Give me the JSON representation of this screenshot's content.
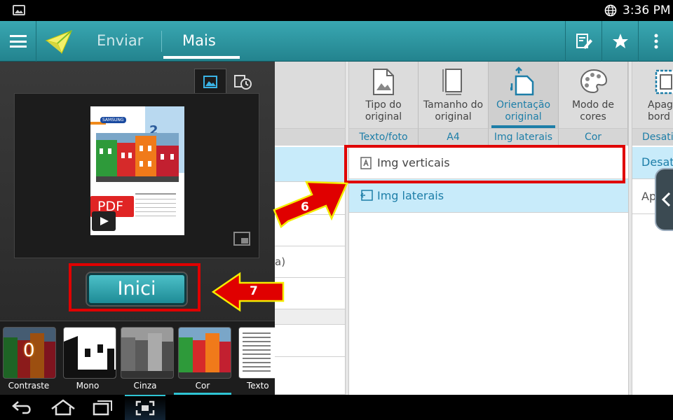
{
  "status": {
    "time": "3:36 PM"
  },
  "appbar": {
    "tabs": [
      {
        "label": "Enviar"
      },
      {
        "label": "Mais"
      }
    ]
  },
  "options": [
    {
      "label": "Tipo do original",
      "value": "Texto/foto"
    },
    {
      "label": "Tamanho do original",
      "value": "A4"
    },
    {
      "label": "Orientação original",
      "value": "Img laterais"
    },
    {
      "label": "Modo de cores",
      "value": "Cor"
    },
    {
      "label": "Apaga bord",
      "value": "Desativ"
    }
  ],
  "dropdown": {
    "items": [
      {
        "label": "Img verticais"
      },
      {
        "label": "Img laterais"
      }
    ]
  },
  "partial_col": {
    "items": [
      "Desat",
      "Ap"
    ]
  },
  "left_remnant": "a)",
  "preview": {
    "page_number": "2",
    "pdf_label": "PDF",
    "samsung": "SAMSUNG"
  },
  "start_button": "Inici",
  "annotations": {
    "arrow6": "6",
    "arrow7": "7"
  },
  "quick": [
    {
      "label": "Contraste",
      "badge": "0"
    },
    {
      "label": "Mono"
    },
    {
      "label": "Cinza"
    },
    {
      "label": "Cor"
    },
    {
      "label": "Texto"
    }
  ],
  "colors": {
    "accent": "#2a9aa6",
    "selected_row": "#c8ebfa",
    "link": "#1d7ea8",
    "highlight": "#e00000"
  }
}
